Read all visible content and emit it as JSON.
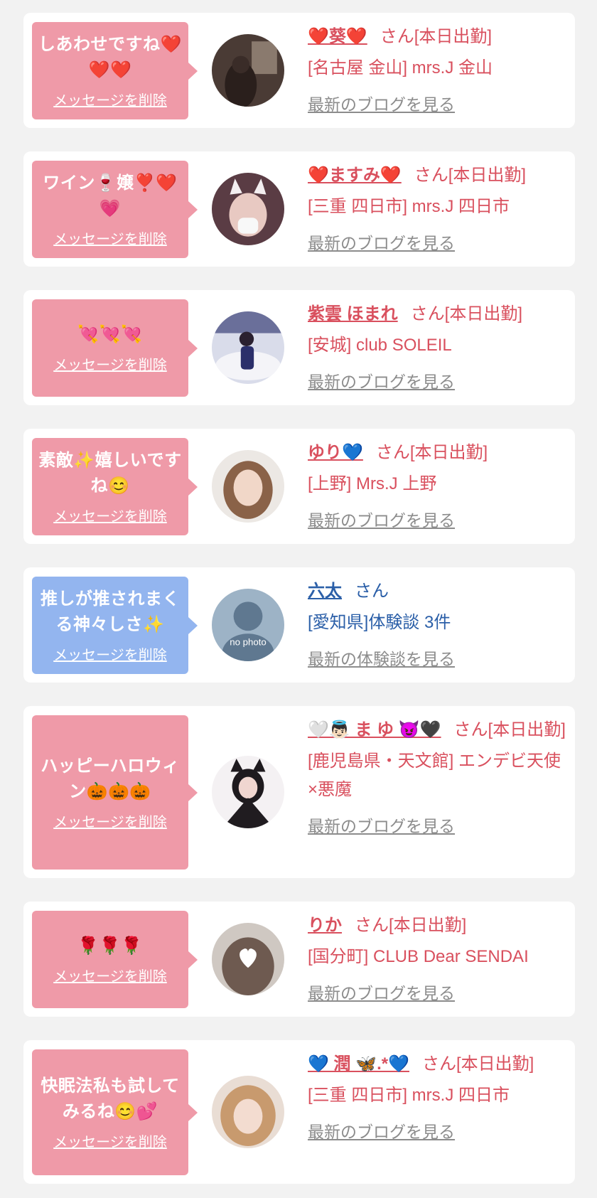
{
  "delete_label": "メッセージを削除",
  "colors": {
    "page_bg": "#f2f2f2",
    "card_bg": "#ffffff",
    "bubble_pink": "#ef9aa8",
    "bubble_blue": "#93b5ef",
    "text_pink": "#d9505e",
    "text_blue": "#2b5fa8",
    "blog_gray": "#8c8c8c"
  },
  "cards": [
    {
      "message": "しあわせですね❤️❤️❤️",
      "name": "❤️葵❤️",
      "suffix": "さん[本日出勤]",
      "shop": "[名古屋 金山] mrs.J 金山",
      "link": "最新のブログを見る",
      "bubble_color": "pink",
      "avatar_icon": "photo-avatar-dim-room"
    },
    {
      "message": "ワイン🍷嬢❣️❤️💗",
      "name": "❤️ますみ❤️",
      "suffix": "さん[本日出勤]",
      "shop": "[三重 四日市] mrs.J 四日市",
      "link": "最新のブログを見る",
      "bubble_color": "pink",
      "avatar_icon": "photo-avatar-cat-ears"
    },
    {
      "message": "💘💘💘",
      "name": "紫雲 ほまれ",
      "suffix": "さん[本日出勤]",
      "shop": "[安城] club SOLEIL",
      "link": "最新のブログを見る",
      "bubble_color": "pink",
      "avatar_icon": "photo-avatar-white-sofa"
    },
    {
      "message": "素敵✨嬉しいですね😊",
      "name": "ゆり💙",
      "suffix": "さん[本日出勤]",
      "shop": "[上野] Mrs.J 上野",
      "link": "最新のブログを見る",
      "bubble_color": "pink",
      "avatar_icon": "photo-avatar-brown-hair"
    },
    {
      "message": "推しが推されまくる神々しさ✨",
      "name": "六太",
      "suffix": "さん",
      "shop": "[愛知県]体験談 3件",
      "link": "最新の体験談を見る",
      "bubble_color": "blue",
      "avatar_icon": "no-photo-silhouette",
      "avatar_text": "no photo"
    },
    {
      "message": "ハッピーハロウィン🎃🎃🎃",
      "name": "🤍👼🏻 ま ゆ 😈🖤",
      "suffix": "さん[本日出勤]",
      "shop": "[鹿児島県・天文館] エンデビ天使×悪魔",
      "link": "最新のブログを見る",
      "bubble_color": "pink",
      "avatar_icon": "photo-avatar-black-costume"
    },
    {
      "message": "🌹🌹🌹",
      "name": "りか",
      "suffix": "さん[本日出勤]",
      "shop": "[国分町] CLUB Dear SENDAI",
      "link": "最新のブログを見る",
      "bubble_color": "pink",
      "avatar_icon": "photo-avatar-heart-face"
    },
    {
      "message": "快眠法私も試してみるね😊💕",
      "name": "💙 潤 🦋.*💙",
      "suffix": "さん[本日出勤]",
      "shop": "[三重 四日市] mrs.J 四日市",
      "link": "最新のブログを見る",
      "bubble_color": "pink",
      "avatar_icon": "photo-avatar-blonde"
    }
  ]
}
